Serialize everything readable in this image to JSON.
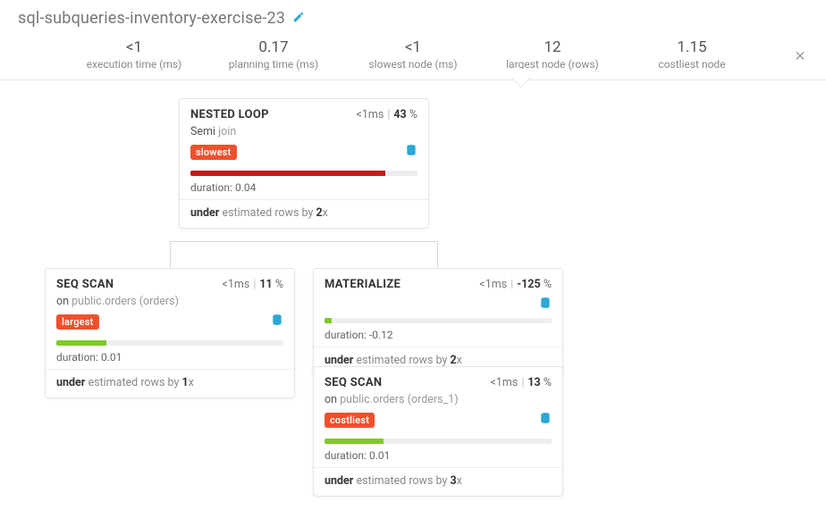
{
  "title": "sql-subqueries-inventory-exercise-23",
  "stats": {
    "exec": {
      "value": "<1",
      "label": "execution time (ms)"
    },
    "plan": {
      "value": "0.17",
      "label": "planning time (ms)"
    },
    "slow": {
      "value": "<1",
      "label": "slowest node (ms)"
    },
    "largest": {
      "value": "12",
      "label": "largest node (rows)"
    },
    "costliest": {
      "value": "1.15",
      "label": "costliest node"
    }
  },
  "nodes": {
    "nestedloop": {
      "name": "NESTED LOOP",
      "time": "<1ms",
      "pct": "43",
      "pct_suffix": " %",
      "join_key": "Semi",
      "join_val": "join",
      "tag": "slowest",
      "duration_label": "duration:",
      "duration": "0.04",
      "est_prefix": "under",
      "est_mid": " estimated rows by ",
      "est_factor": "2",
      "est_suffix": "x"
    },
    "seqscan1": {
      "name": "SEQ SCAN",
      "time": "<1ms",
      "pct": "11",
      "pct_suffix": " %",
      "on_key": "on",
      "on_val": "public.orders (orders)",
      "tag": "largest",
      "duration_label": "duration:",
      "duration": "0.01",
      "est_prefix": "under",
      "est_mid": " estimated rows by ",
      "est_factor": "1",
      "est_suffix": "x"
    },
    "materialize": {
      "name": "MATERIALIZE",
      "time": "<1ms",
      "pct": "-125",
      "pct_suffix": " %",
      "duration_label": "duration:",
      "duration": "-0.12",
      "est_prefix": "under",
      "est_mid": " estimated rows by ",
      "est_factor": "2",
      "est_suffix": "x"
    },
    "seqscan2": {
      "name": "SEQ SCAN",
      "time": "<1ms",
      "pct": "13",
      "pct_suffix": " %",
      "on_key": "on",
      "on_val": "public.orders (orders_1)",
      "tag": "costliest",
      "duration_label": "duration:",
      "duration": "0.01",
      "est_prefix": "under",
      "est_mid": " estimated rows by ",
      "est_factor": "3",
      "est_suffix": "x"
    }
  }
}
